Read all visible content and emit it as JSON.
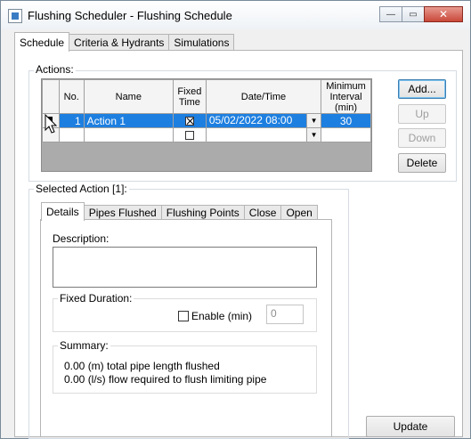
{
  "window": {
    "title": "Flushing Scheduler - Flushing Schedule",
    "minimize_glyph": "—",
    "maximize_glyph": "▭",
    "close_glyph": "✕"
  },
  "tabs": [
    {
      "label": "Schedule",
      "active": true
    },
    {
      "label": "Criteria & Hydrants",
      "active": false
    },
    {
      "label": "Simulations",
      "active": false
    }
  ],
  "actions": {
    "label": "Actions:",
    "columns": {
      "no": "No.",
      "name": "Name",
      "fixed_time": "Fixed Time",
      "datetime": "Date/Time",
      "min_interval": "Minimum Interval (min)"
    },
    "rows": [
      {
        "no": "1",
        "name": "Action 1",
        "fixed_time": true,
        "datetime": "05/02/2022 08:00",
        "min_interval": "30",
        "selected": true
      },
      {
        "no": "",
        "name": "",
        "fixed_time": false,
        "datetime": "",
        "min_interval": "",
        "selected": false
      }
    ],
    "buttons": {
      "add": "Add...",
      "up": "Up",
      "down": "Down",
      "delete": "Delete"
    }
  },
  "selected_action": {
    "label": "Selected Action [1]:",
    "tabs": [
      {
        "label": "Details",
        "active": true
      },
      {
        "label": "Pipes Flushed",
        "active": false
      },
      {
        "label": "Flushing Points",
        "active": false
      },
      {
        "label": "Close",
        "active": false
      },
      {
        "label": "Open",
        "active": false
      }
    ],
    "description_label": "Description:",
    "description_value": "",
    "fixed_duration_label": "Fixed Duration:",
    "enable_label": "Enable (min)",
    "enable_checked": false,
    "duration_value": "0",
    "summary_label": "Summary:",
    "summary_lines": [
      "0.00 (m) total pipe length flushed",
      "0.00 (l/s) flow required to flush limiting pipe"
    ]
  },
  "update_button": "Update",
  "dropdown_glyph": "▼"
}
